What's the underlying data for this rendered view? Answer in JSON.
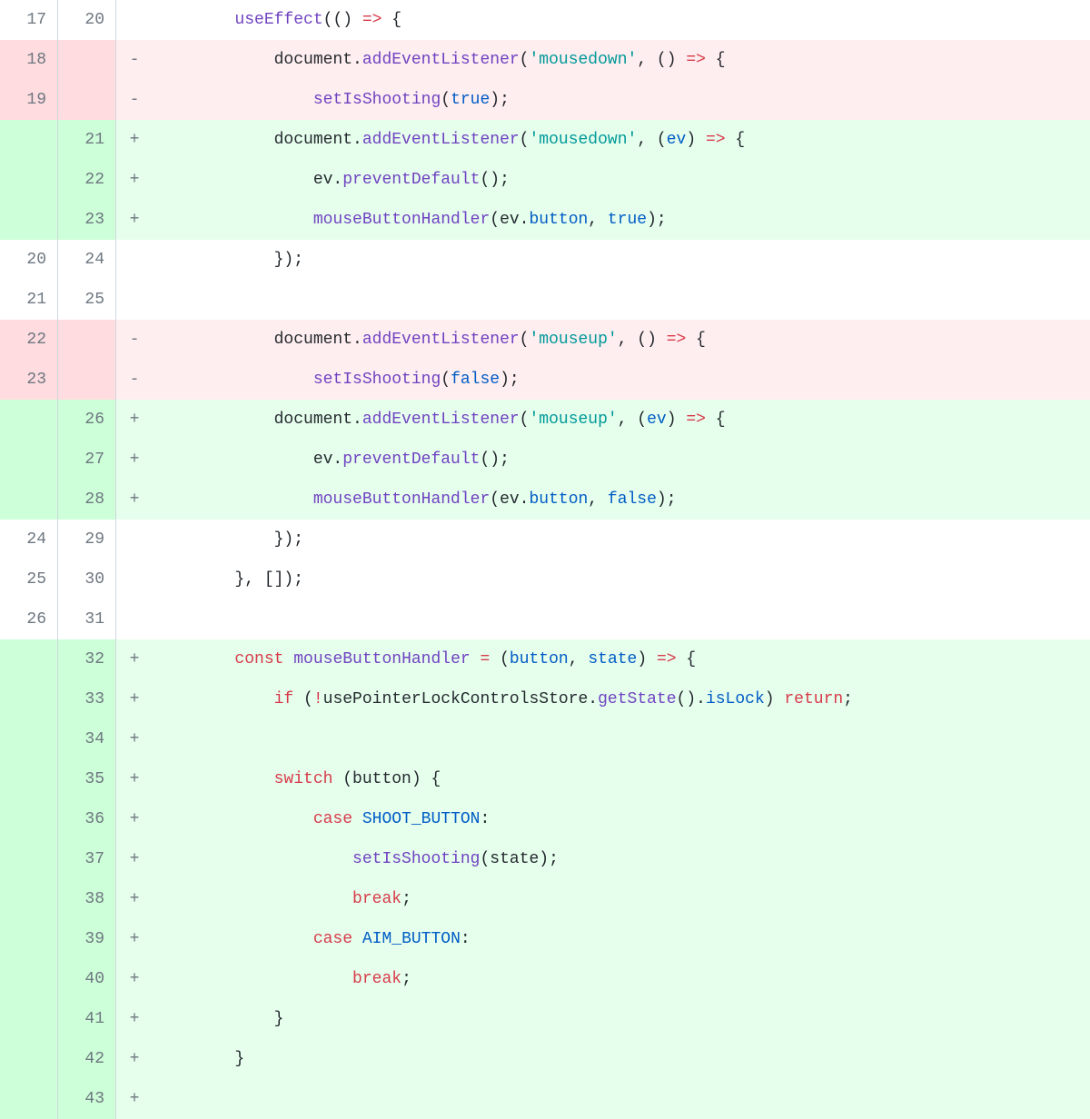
{
  "diff": {
    "rows": [
      {
        "type": "ctx",
        "old": "17",
        "new": "20",
        "sym": " ",
        "tokens": [
          {
            "t": "        ",
            "c": ""
          },
          {
            "t": "useEffect",
            "c": "tok-fn"
          },
          {
            "t": "(() ",
            "c": ""
          },
          {
            "t": "=>",
            "c": "tok-kw"
          },
          {
            "t": " {",
            "c": ""
          }
        ]
      },
      {
        "type": "del",
        "old": "18",
        "new": "",
        "sym": "-",
        "tokens": [
          {
            "t": "            document.",
            "c": ""
          },
          {
            "t": "addEventListener",
            "c": "tok-fn"
          },
          {
            "t": "(",
            "c": ""
          },
          {
            "t": "'mousedown'",
            "c": "tok-str"
          },
          {
            "t": ", () ",
            "c": ""
          },
          {
            "t": "=>",
            "c": "tok-kw"
          },
          {
            "t": " {",
            "c": ""
          }
        ]
      },
      {
        "type": "del",
        "old": "19",
        "new": "",
        "sym": "-",
        "tokens": [
          {
            "t": "                ",
            "c": ""
          },
          {
            "t": "setIsShooting",
            "c": "tok-fn"
          },
          {
            "t": "(",
            "c": ""
          },
          {
            "t": "true",
            "c": "tok-num"
          },
          {
            "t": ");",
            "c": ""
          }
        ]
      },
      {
        "type": "add",
        "old": "",
        "new": "21",
        "sym": "+",
        "tokens": [
          {
            "t": "            document.",
            "c": ""
          },
          {
            "t": "addEventListener",
            "c": "tok-fn"
          },
          {
            "t": "(",
            "c": ""
          },
          {
            "t": "'mousedown'",
            "c": "tok-str"
          },
          {
            "t": ", (",
            "c": ""
          },
          {
            "t": "ev",
            "c": "tok-prop"
          },
          {
            "t": ") ",
            "c": ""
          },
          {
            "t": "=>",
            "c": "tok-kw"
          },
          {
            "t": " {",
            "c": ""
          }
        ]
      },
      {
        "type": "add",
        "old": "",
        "new": "22",
        "sym": "+",
        "tokens": [
          {
            "t": "                ev.",
            "c": ""
          },
          {
            "t": "preventDefault",
            "c": "tok-fn"
          },
          {
            "t": "();",
            "c": ""
          }
        ]
      },
      {
        "type": "add",
        "old": "",
        "new": "23",
        "sym": "+",
        "tokens": [
          {
            "t": "                ",
            "c": ""
          },
          {
            "t": "mouseButtonHandler",
            "c": "tok-fn"
          },
          {
            "t": "(ev.",
            "c": ""
          },
          {
            "t": "button",
            "c": "tok-prop"
          },
          {
            "t": ", ",
            "c": ""
          },
          {
            "t": "true",
            "c": "tok-num"
          },
          {
            "t": ");",
            "c": ""
          }
        ]
      },
      {
        "type": "ctx",
        "old": "20",
        "new": "24",
        "sym": " ",
        "tokens": [
          {
            "t": "            });",
            "c": ""
          }
        ]
      },
      {
        "type": "ctx",
        "old": "21",
        "new": "25",
        "sym": " ",
        "tokens": [
          {
            "t": "",
            "c": ""
          }
        ]
      },
      {
        "type": "del",
        "old": "22",
        "new": "",
        "sym": "-",
        "tokens": [
          {
            "t": "            document.",
            "c": ""
          },
          {
            "t": "addEventListener",
            "c": "tok-fn"
          },
          {
            "t": "(",
            "c": ""
          },
          {
            "t": "'mouseup'",
            "c": "tok-str"
          },
          {
            "t": ", () ",
            "c": ""
          },
          {
            "t": "=>",
            "c": "tok-kw"
          },
          {
            "t": " {",
            "c": ""
          }
        ]
      },
      {
        "type": "del",
        "old": "23",
        "new": "",
        "sym": "-",
        "tokens": [
          {
            "t": "                ",
            "c": ""
          },
          {
            "t": "setIsShooting",
            "c": "tok-fn"
          },
          {
            "t": "(",
            "c": ""
          },
          {
            "t": "false",
            "c": "tok-num"
          },
          {
            "t": ");",
            "c": ""
          }
        ]
      },
      {
        "type": "add",
        "old": "",
        "new": "26",
        "sym": "+",
        "tokens": [
          {
            "t": "            document.",
            "c": ""
          },
          {
            "t": "addEventListener",
            "c": "tok-fn"
          },
          {
            "t": "(",
            "c": ""
          },
          {
            "t": "'mouseup'",
            "c": "tok-str"
          },
          {
            "t": ", (",
            "c": ""
          },
          {
            "t": "ev",
            "c": "tok-prop"
          },
          {
            "t": ") ",
            "c": ""
          },
          {
            "t": "=>",
            "c": "tok-kw"
          },
          {
            "t": " {",
            "c": ""
          }
        ]
      },
      {
        "type": "add",
        "old": "",
        "new": "27",
        "sym": "+",
        "tokens": [
          {
            "t": "                ev.",
            "c": ""
          },
          {
            "t": "preventDefault",
            "c": "tok-fn"
          },
          {
            "t": "();",
            "c": ""
          }
        ]
      },
      {
        "type": "add",
        "old": "",
        "new": "28",
        "sym": "+",
        "tokens": [
          {
            "t": "                ",
            "c": ""
          },
          {
            "t": "mouseButtonHandler",
            "c": "tok-fn"
          },
          {
            "t": "(ev.",
            "c": ""
          },
          {
            "t": "button",
            "c": "tok-prop"
          },
          {
            "t": ", ",
            "c": ""
          },
          {
            "t": "false",
            "c": "tok-num"
          },
          {
            "t": ");",
            "c": ""
          }
        ]
      },
      {
        "type": "ctx",
        "old": "24",
        "new": "29",
        "sym": " ",
        "tokens": [
          {
            "t": "            });",
            "c": ""
          }
        ]
      },
      {
        "type": "ctx",
        "old": "25",
        "new": "30",
        "sym": " ",
        "tokens": [
          {
            "t": "        }, []);",
            "c": ""
          }
        ]
      },
      {
        "type": "ctx",
        "old": "26",
        "new": "31",
        "sym": " ",
        "tokens": [
          {
            "t": "",
            "c": ""
          }
        ]
      },
      {
        "type": "add",
        "old": "",
        "new": "32",
        "sym": "+",
        "tokens": [
          {
            "t": "        ",
            "c": ""
          },
          {
            "t": "const",
            "c": "tok-kw"
          },
          {
            "t": " ",
            "c": ""
          },
          {
            "t": "mouseButtonHandler",
            "c": "tok-fn"
          },
          {
            "t": " ",
            "c": ""
          },
          {
            "t": "=",
            "c": "tok-kw"
          },
          {
            "t": " (",
            "c": ""
          },
          {
            "t": "button",
            "c": "tok-prop"
          },
          {
            "t": ", ",
            "c": ""
          },
          {
            "t": "state",
            "c": "tok-prop"
          },
          {
            "t": ") ",
            "c": ""
          },
          {
            "t": "=>",
            "c": "tok-kw"
          },
          {
            "t": " {",
            "c": ""
          }
        ]
      },
      {
        "type": "add",
        "old": "",
        "new": "33",
        "sym": "+",
        "tokens": [
          {
            "t": "            ",
            "c": ""
          },
          {
            "t": "if",
            "c": "tok-kw"
          },
          {
            "t": " (",
            "c": ""
          },
          {
            "t": "!",
            "c": "tok-kw"
          },
          {
            "t": "usePointerLockControlsStore.",
            "c": ""
          },
          {
            "t": "getState",
            "c": "tok-fn"
          },
          {
            "t": "().",
            "c": ""
          },
          {
            "t": "isLock",
            "c": "tok-prop"
          },
          {
            "t": ") ",
            "c": ""
          },
          {
            "t": "return",
            "c": "tok-kw"
          },
          {
            "t": ";",
            "c": ""
          }
        ]
      },
      {
        "type": "add",
        "old": "",
        "new": "34",
        "sym": "+",
        "tokens": [
          {
            "t": "",
            "c": ""
          }
        ]
      },
      {
        "type": "add",
        "old": "",
        "new": "35",
        "sym": "+",
        "tokens": [
          {
            "t": "            ",
            "c": ""
          },
          {
            "t": "switch",
            "c": "tok-kw"
          },
          {
            "t": " (button) {",
            "c": ""
          }
        ]
      },
      {
        "type": "add",
        "old": "",
        "new": "36",
        "sym": "+",
        "tokens": [
          {
            "t": "                ",
            "c": ""
          },
          {
            "t": "case",
            "c": "tok-kw"
          },
          {
            "t": " ",
            "c": ""
          },
          {
            "t": "SHOOT_BUTTON",
            "c": "tok-prop"
          },
          {
            "t": ":",
            "c": ""
          }
        ]
      },
      {
        "type": "add",
        "old": "",
        "new": "37",
        "sym": "+",
        "tokens": [
          {
            "t": "                    ",
            "c": ""
          },
          {
            "t": "setIsShooting",
            "c": "tok-fn"
          },
          {
            "t": "(state);",
            "c": ""
          }
        ]
      },
      {
        "type": "add",
        "old": "",
        "new": "38",
        "sym": "+",
        "tokens": [
          {
            "t": "                    ",
            "c": ""
          },
          {
            "t": "break",
            "c": "tok-kw"
          },
          {
            "t": ";",
            "c": ""
          }
        ]
      },
      {
        "type": "add",
        "old": "",
        "new": "39",
        "sym": "+",
        "tokens": [
          {
            "t": "                ",
            "c": ""
          },
          {
            "t": "case",
            "c": "tok-kw"
          },
          {
            "t": " ",
            "c": ""
          },
          {
            "t": "AIM_BUTTON",
            "c": "tok-prop"
          },
          {
            "t": ":",
            "c": ""
          }
        ]
      },
      {
        "type": "add",
        "old": "",
        "new": "40",
        "sym": "+",
        "tokens": [
          {
            "t": "                    ",
            "c": ""
          },
          {
            "t": "break",
            "c": "tok-kw"
          },
          {
            "t": ";",
            "c": ""
          }
        ]
      },
      {
        "type": "add",
        "old": "",
        "new": "41",
        "sym": "+",
        "tokens": [
          {
            "t": "            }",
            "c": ""
          }
        ]
      },
      {
        "type": "add",
        "old": "",
        "new": "42",
        "sym": "+",
        "tokens": [
          {
            "t": "        }",
            "c": ""
          }
        ]
      },
      {
        "type": "add",
        "old": "",
        "new": "43",
        "sym": "+",
        "tokens": [
          {
            "t": "",
            "c": ""
          }
        ]
      }
    ]
  }
}
